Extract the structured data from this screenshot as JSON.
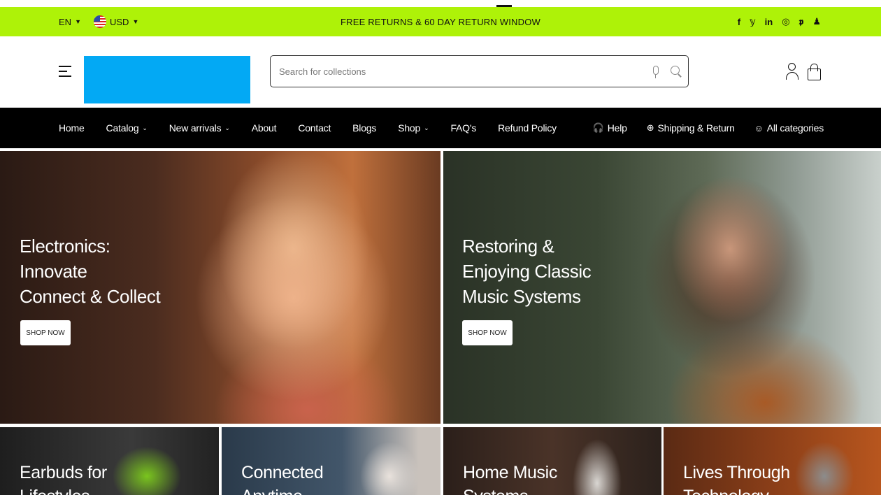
{
  "announcement": {
    "language": "EN",
    "currency": "USD",
    "message": "FREE RETURNS & 60 DAY RETURN WINDOW",
    "socials": [
      "f",
      "𝕪",
      "in",
      "◎",
      "𝖕",
      "♟"
    ],
    "bg_color": "#aef208"
  },
  "header": {
    "search_placeholder": "Search for collections"
  },
  "nav": {
    "items": [
      {
        "label": "Home"
      },
      {
        "label": "Catalog",
        "dropdown": "⌄"
      },
      {
        "label": "New arrivals",
        "dropdown": "⌄"
      },
      {
        "label": "About"
      },
      {
        "label": "Contact"
      },
      {
        "label": "Blogs"
      },
      {
        "label": "Shop",
        "dropdown": "⌄"
      },
      {
        "label": "FAQ's"
      },
      {
        "label": "Refund Policy"
      }
    ],
    "right_items": [
      {
        "icon": "🎧",
        "label": "Help"
      },
      {
        "icon": "⊕",
        "label": "Shipping & Return"
      },
      {
        "icon": "☺",
        "label": "All categories"
      }
    ]
  },
  "banners": [
    {
      "title": "Electronics:\nInnovate\nConnect & Collect",
      "button": "SHOP NOW"
    },
    {
      "title": "Restoring &\nEnjoying Classic\nMusic Systems",
      "button": "SHOP NOW"
    }
  ],
  "tiles": [
    {
      "title": "Earbuds for\nLifestyles"
    },
    {
      "title": "Connected\nAnytime"
    },
    {
      "title": "Home Music\nSystems"
    },
    {
      "title": "Lives Through\nTechnology"
    }
  ]
}
